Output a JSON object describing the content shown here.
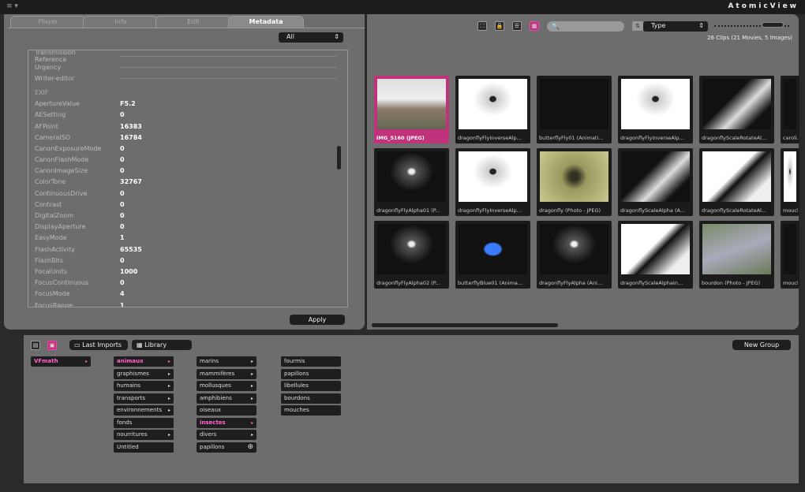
{
  "app": {
    "title": "AtomicView"
  },
  "tabs": [
    {
      "label": "Player"
    },
    {
      "label": "Info"
    },
    {
      "label": "Edit"
    },
    {
      "label": "Metadata",
      "active": true
    }
  ],
  "filter": {
    "selected": "All"
  },
  "metadata": {
    "iptc": [
      {
        "key": "Transmission Reference"
      },
      {
        "key": "Urgency"
      },
      {
        "key": "Writer-editor"
      }
    ],
    "exif_label": "EXIF",
    "exif": [
      {
        "key": "ApertureValue",
        "value": "F5.2"
      },
      {
        "key": "AESetting",
        "value": "0"
      },
      {
        "key": "AFPoint",
        "value": "16383"
      },
      {
        "key": "CameraISO",
        "value": "16784"
      },
      {
        "key": "CanonExposureMode",
        "value": "0"
      },
      {
        "key": "CanonFlashMode",
        "value": "0"
      },
      {
        "key": "CanonImageSize",
        "value": "0"
      },
      {
        "key": "ColorTone",
        "value": "32767"
      },
      {
        "key": "ContinuousDrive",
        "value": "0"
      },
      {
        "key": "Contrast",
        "value": "0"
      },
      {
        "key": "DigitalZoom",
        "value": "0"
      },
      {
        "key": "DisplayAperture",
        "value": "0"
      },
      {
        "key": "EasyMode",
        "value": "1"
      },
      {
        "key": "FlashActivity",
        "value": "65535"
      },
      {
        "key": "FlashBits",
        "value": "0"
      },
      {
        "key": "FocalUnits",
        "value": "1000"
      },
      {
        "key": "FocusContinuous",
        "value": "0"
      },
      {
        "key": "FocusMode",
        "value": "4"
      },
      {
        "key": "FocusRange",
        "value": "1"
      }
    ]
  },
  "apply_label": "Apply",
  "browser": {
    "search_placeholder": "",
    "sort": {
      "selected": "Type"
    },
    "clip_count": "26 Clips  (21 Movies, 5 Images)",
    "zoom_level": 0.85,
    "accent": "#c0337a",
    "thumbs": [
      {
        "label": "IMG_5160 (JPEG)",
        "kind": "photo-ant",
        "selected": true
      },
      {
        "label": "dragonflyFlyInverseAlp...",
        "kind": "white"
      },
      {
        "label": "butterflyFly01 (Animati...",
        "kind": "black"
      },
      {
        "label": "dragonflyFlyInverseAlp...",
        "kind": "white"
      },
      {
        "label": "dragonflyScaleRotateAl...",
        "kind": "dark-wing"
      },
      {
        "label": "caroli...",
        "kind": "black"
      },
      {
        "label": "dragonflyFlyAlpha01 (P...",
        "kind": "black-fly"
      },
      {
        "label": "dragonflyFlyInverseAlp...",
        "kind": "white"
      },
      {
        "label": "dragonfly (Photo - JPEG)",
        "kind": "olive"
      },
      {
        "label": "dragonflyScaleAlpha (A...",
        "kind": "dark-wing"
      },
      {
        "label": "dragonflyScaleRotateAl...",
        "kind": "white-wing"
      },
      {
        "label": "mouch...",
        "kind": "white"
      },
      {
        "label": "dragonflyFlyAlpha02 (P...",
        "kind": "black-fly"
      },
      {
        "label": "butterflyBlue01 (Anima...",
        "kind": "blue"
      },
      {
        "label": "dragonflyFlyAlpha (Ani...",
        "kind": "black-fly"
      },
      {
        "label": "dragonflyScaleAlphaIn...",
        "kind": "white-wing"
      },
      {
        "label": "bourdon (Photo - JPEG)",
        "kind": "green"
      },
      {
        "label": "mouch...",
        "kind": "black"
      }
    ]
  },
  "collections": {
    "last_imports": "Last Imports",
    "library": "Library",
    "new_group": "New Group",
    "root": [
      {
        "label": "VFmath",
        "arrow": true,
        "hl": true
      }
    ],
    "col1": [
      {
        "label": "animaux",
        "arrow": true,
        "hl": true
      },
      {
        "label": "graphismes",
        "arrow": true
      },
      {
        "label": "humains",
        "arrow": true
      },
      {
        "label": "transports",
        "arrow": true
      },
      {
        "label": "environnements",
        "arrow": true
      },
      {
        "label": "fonds"
      },
      {
        "label": "nourritures",
        "arrow": true
      },
      {
        "label": "Untitled"
      }
    ],
    "col2": [
      {
        "label": "marins",
        "arrow": true
      },
      {
        "label": "mammifères",
        "arrow": true
      },
      {
        "label": "mollusques",
        "arrow": true
      },
      {
        "label": "amphibiens",
        "arrow": true
      },
      {
        "label": "oiseaux"
      },
      {
        "label": "insectes",
        "arrow": true,
        "hl": true
      },
      {
        "label": "divers",
        "arrow": true
      },
      {
        "label": "papillons",
        "add": true
      }
    ],
    "col3": [
      {
        "label": "fourmis"
      },
      {
        "label": "papillons"
      },
      {
        "label": "libellules"
      },
      {
        "label": "bourdons"
      },
      {
        "label": "mouches"
      }
    ]
  }
}
